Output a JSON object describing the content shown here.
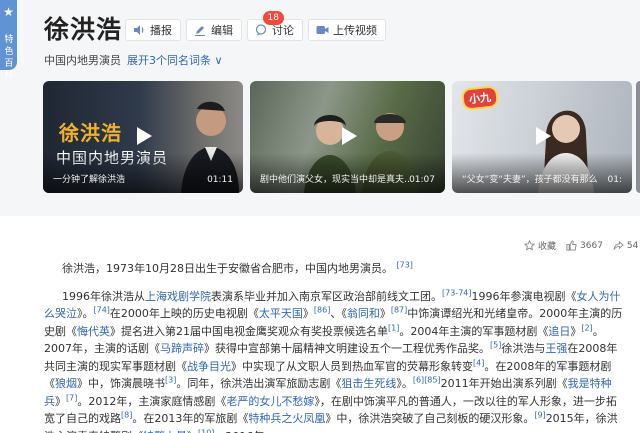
{
  "side_badge": {
    "text": "特色百科"
  },
  "entry": {
    "title": "徐洪浩",
    "subtitle": "中国内地男演员",
    "same_name": "展开3个同名词条",
    "chevron": "∨"
  },
  "actions": [
    {
      "label": "播报",
      "icon": "speaker-icon"
    },
    {
      "label": "编辑",
      "icon": "edit-icon"
    },
    {
      "label": "讨论",
      "icon": "chat-icon",
      "badge": "18"
    },
    {
      "label": "上传视频",
      "icon": "video-upload-icon"
    }
  ],
  "videos": [
    {
      "caption": "一分钟了解徐洪浩",
      "duration": "01:11",
      "overlay_name": "徐洪浩",
      "overlay_sub": "中国内地男演员"
    },
    {
      "caption": "剧中他们演父女，现实当中却是真夫…",
      "duration": "01:07"
    },
    {
      "caption": "“父女”变“夫妻”，孩子都没有那么",
      "duration": "01:",
      "logo": "小九"
    }
  ],
  "stats": {
    "collect_label": "收藏",
    "likes": "3667",
    "shares": "54"
  },
  "article": {
    "intro": "徐洪浩，1973年10月28日出生于安徽省合肥市，中国内地男演员。",
    "intro_ref": "[73]",
    "p2": [
      {
        "t": "1996年徐洪浩从"
      },
      {
        "t": "上海戏剧学院",
        "link": true
      },
      {
        "t": "表演系毕业并加入南京军区政治部前线文工团。"
      },
      {
        "t": "[73-74]",
        "ref": true
      },
      {
        "t": "1996年参演电视剧《"
      },
      {
        "t": "女人为什么哭泣",
        "link": true
      },
      {
        "t": "》。"
      },
      {
        "t": "[74]",
        "ref": true
      },
      {
        "t": "在2000年上映的历史电视剧《"
      },
      {
        "t": "太平天国",
        "link": true
      },
      {
        "t": "》"
      },
      {
        "t": "[86]",
        "ref": true
      },
      {
        "t": "、《"
      },
      {
        "t": "翁同和",
        "link": true
      },
      {
        "t": "》"
      },
      {
        "t": "[87]",
        "ref": true
      },
      {
        "t": "中饰演谭绍光和光绪皇帝。2000年主演的历史剧《"
      },
      {
        "t": "悔代英",
        "link": true
      },
      {
        "t": "》提名进入第21届中国电视金鹰奖观众有奖投票候选名单"
      },
      {
        "t": "[1]",
        "ref": true
      },
      {
        "t": "。2004年主演的军事题材剧《"
      },
      {
        "t": "追日",
        "link": true
      },
      {
        "t": "》"
      },
      {
        "t": "[2]",
        "ref": true
      },
      {
        "t": "。2007年，主演的话剧《"
      },
      {
        "t": "马蹄声碎",
        "link": true
      },
      {
        "t": "》获得中宣部第十届精神文明建设五个一工程优秀作品奖。"
      },
      {
        "t": "[5]",
        "ref": true
      },
      {
        "t": "徐洪浩与"
      },
      {
        "t": "王强",
        "link": true
      },
      {
        "t": "在2008年共同主演的现实军事题材剧《"
      },
      {
        "t": "战争目光",
        "link": true
      },
      {
        "t": "》中实现了从文职人员到热血军官的荧幕形象转变"
      },
      {
        "t": "[4]",
        "ref": true
      },
      {
        "t": "。在2008年的军事题材剧《"
      },
      {
        "t": "狼烟",
        "link": true
      },
      {
        "t": "》中，饰演晨晓书"
      },
      {
        "t": "[3]",
        "ref": true
      },
      {
        "t": "。同年，徐洪浩出演军旅励志剧《"
      },
      {
        "t": "狙击生死线",
        "link": true
      },
      {
        "t": "》。"
      },
      {
        "t": "[6]",
        "ref": true
      },
      {
        "t": "[85]",
        "ref": true
      },
      {
        "t": "2011年开始出演系列剧《"
      },
      {
        "t": "我是特种兵",
        "link": true
      },
      {
        "t": "》"
      },
      {
        "t": "[7]",
        "ref": true
      },
      {
        "t": "。2012年，主演家庭情感剧《"
      },
      {
        "t": "老严的女儿不愁嫁",
        "link": true
      },
      {
        "t": "》，在剧中饰演平凡的普通人，一改以往的军人形象，进一步拓宽了自己的戏路"
      },
      {
        "t": "[8]",
        "ref": true
      },
      {
        "t": "。在2013年的军旅剧《"
      },
      {
        "t": "特种兵之火凤凰",
        "link": true
      },
      {
        "t": "》中，徐洪浩突破了自己刻板的硬汉形象。"
      },
      {
        "t": "[9]",
        "ref": true
      },
      {
        "t": "2015年，徐洪浩主演青春特警剧《"
      },
      {
        "t": "特警力量",
        "link": true
      },
      {
        "t": "》"
      },
      {
        "t": "[10]",
        "ref": true
      },
      {
        "t": "。2016年，"
      }
    ]
  },
  "colors": {
    "accent_blue": "#3466b3",
    "badge_red": "#f4483a",
    "name_gold": "#f0b22c"
  }
}
